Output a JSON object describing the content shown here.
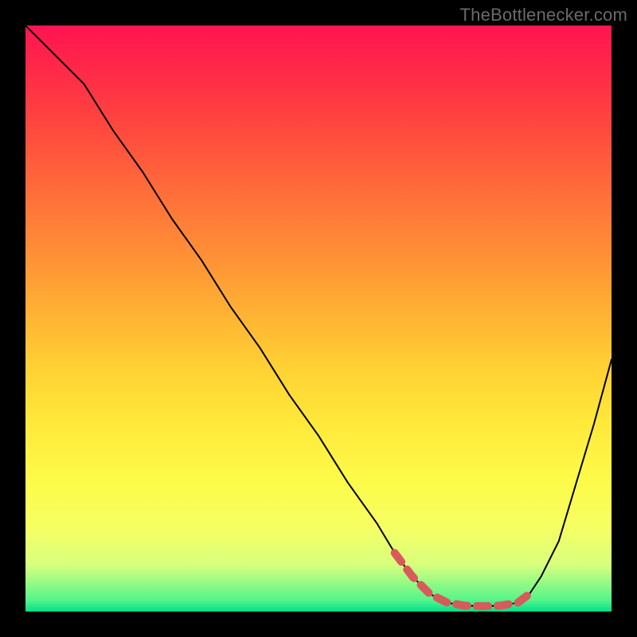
{
  "watermark": "TheBottlenecker.com",
  "chart_data": {
    "type": "line",
    "title": "",
    "xlabel": "",
    "ylabel": "",
    "xlim": [
      0,
      100
    ],
    "ylim": [
      0,
      100
    ],
    "series": [
      {
        "name": "curve",
        "color": "#000000",
        "x": [
          0,
          3,
          6,
          10,
          15,
          20,
          25,
          30,
          35,
          40,
          45,
          50,
          55,
          60,
          63,
          66,
          69,
          72,
          75,
          78,
          81,
          84,
          86,
          88,
          91,
          94,
          97,
          100
        ],
        "y": [
          100,
          97,
          94,
          90,
          82,
          75,
          67,
          60,
          52,
          45,
          37,
          30,
          22,
          15,
          10,
          6,
          3,
          1.5,
          1,
          0.9,
          1,
          1.5,
          3,
          6,
          12,
          22,
          32,
          43
        ]
      },
      {
        "name": "highlight",
        "color": "#d85a5a",
        "x": [
          63,
          66,
          69,
          72,
          75,
          78,
          81,
          84,
          86
        ],
        "y": [
          10,
          6,
          3,
          1.5,
          1,
          0.9,
          1,
          1.5,
          3
        ],
        "stroke_width": 10,
        "dash": true
      }
    ]
  }
}
